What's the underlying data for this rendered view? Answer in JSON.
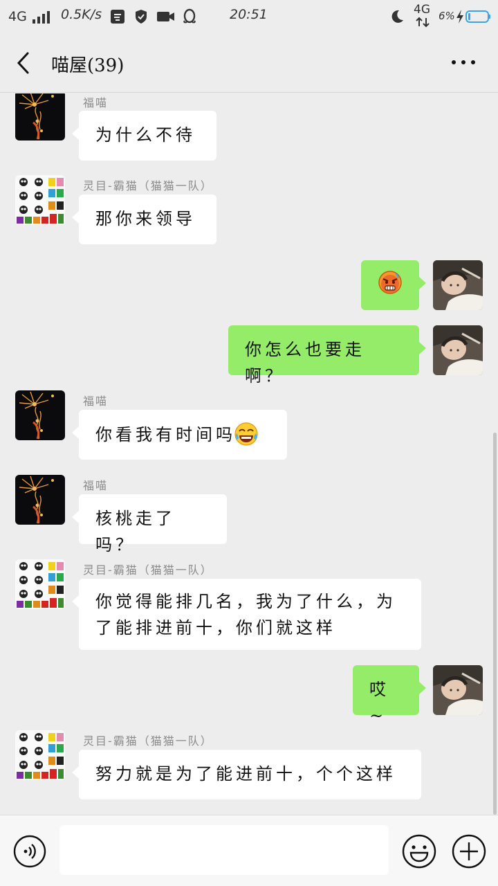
{
  "status_bar": {
    "network": "4G",
    "speed": "0.5K/s",
    "time": "20:51",
    "network_right": "4G",
    "battery": "6%"
  },
  "header": {
    "back_icon": "chevron-left-icon",
    "title": "喵屋(39)",
    "more_icon": "more-dots-icon"
  },
  "messages": [
    {
      "side": "in",
      "sender": "福喵",
      "text": "为什么不待"
    },
    {
      "side": "in",
      "sender": "灵目-霸猫（猫猫一队）",
      "text": "那你来领导"
    },
    {
      "side": "out",
      "text": "",
      "emoji": "angry-face-emoji"
    },
    {
      "side": "out",
      "text": "你怎么也要走啊？"
    },
    {
      "side": "in",
      "sender": "福喵",
      "text": "你看我有时间吗",
      "emoji": "tears-of-joy-emoji"
    },
    {
      "side": "in",
      "sender": "福喵",
      "text": "核桃走了吗？"
    },
    {
      "side": "in",
      "sender": "灵目-霸猫（猫猫一队）",
      "text": "你觉得能排几名，我为了什么，为了能排进前十，你们就这样"
    },
    {
      "side": "out",
      "text": "哎~"
    },
    {
      "side": "in",
      "sender": "灵目-霸猫（猫猫一队）",
      "text": "努力就是为了能进前十，个个这样"
    }
  ],
  "bottom_bar": {
    "voice_icon": "voice-icon",
    "input_value": "",
    "emoji_icon": "emoji-icon",
    "plus_icon": "plus-icon"
  },
  "colors": {
    "background": "#ededed",
    "outgoing_bubble": "#95ec69",
    "incoming_bubble": "#ffffff"
  }
}
